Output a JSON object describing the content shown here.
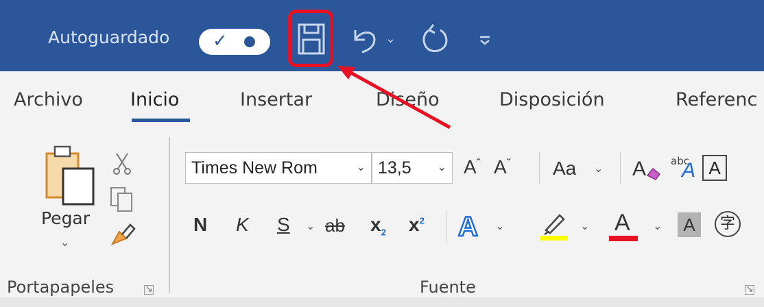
{
  "titlebar": {
    "autosave_label": "Autoguardado",
    "autosave_on": true,
    "quick_access": [
      "save-icon",
      "undo-icon",
      "redo-icon",
      "customize-icon"
    ],
    "bg_color": "#2b579a"
  },
  "tabs": [
    {
      "label": "Archivo"
    },
    {
      "label": "Inicio"
    },
    {
      "label": "Insertar"
    },
    {
      "label": "Diseño"
    },
    {
      "label": "Disposición"
    },
    {
      "label": "Referenc"
    }
  ],
  "active_tab": "Inicio",
  "clipboard": {
    "paste_label": "Pegar",
    "group_label": "Portapapeles"
  },
  "font": {
    "font_name": "Times New Rom",
    "font_size": "13,5",
    "case_label": "Aa",
    "bold_label": "N",
    "italic_label": "K",
    "underline_label": "S",
    "strike_label": "ab",
    "subscript_label": "x",
    "subscript_mark": "2",
    "superscript_label": "x",
    "superscript_mark": "2",
    "grow_label": "A",
    "shrink_label": "A",
    "text_effects_label": "A",
    "highlight_color": "#ffff00",
    "font_color": "#e81123",
    "font_color_label": "A",
    "char_shading_label": "A",
    "char_border_label": "A",
    "phonetic_label": "abc",
    "enclose_label": "字",
    "group_label": "Fuente"
  },
  "annotation": {
    "highlight_color": "#e81123",
    "target": "save-button"
  }
}
